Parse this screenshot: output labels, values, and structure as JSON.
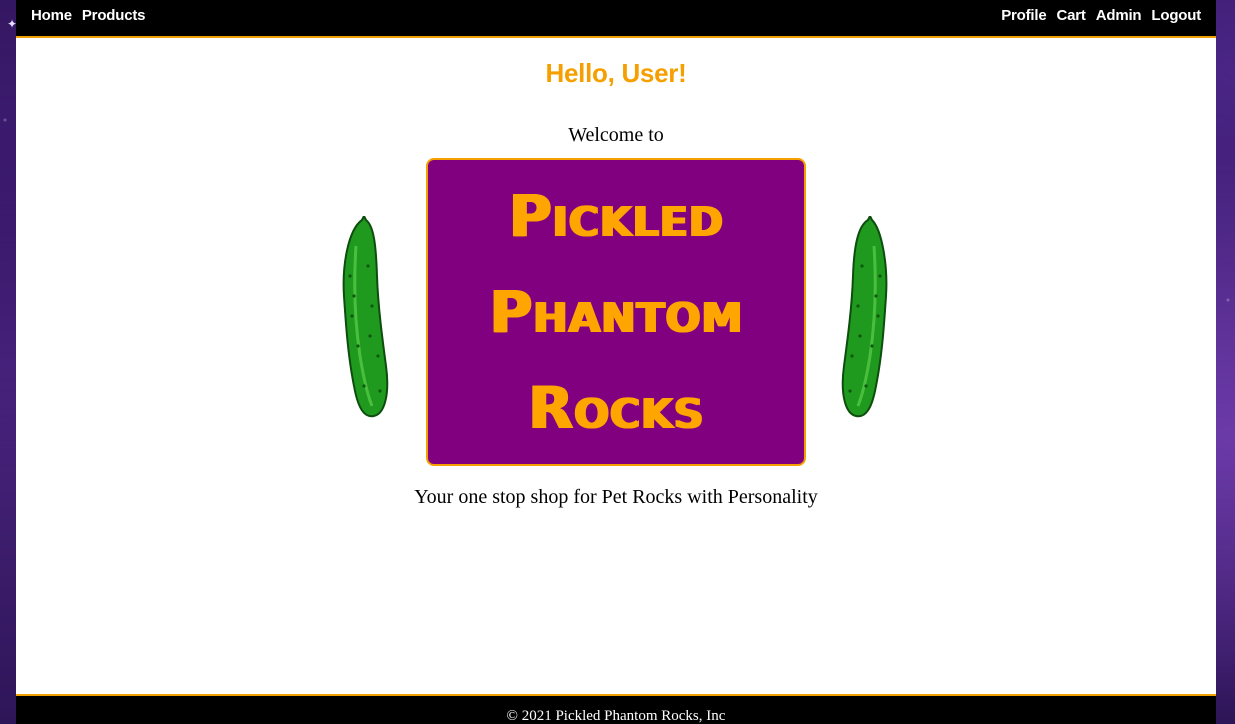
{
  "nav": {
    "left": [
      {
        "label": "Home"
      },
      {
        "label": "Products"
      }
    ],
    "right": [
      {
        "label": "Profile"
      },
      {
        "label": "Cart"
      },
      {
        "label": "Admin"
      },
      {
        "label": "Logout"
      }
    ]
  },
  "main": {
    "greeting": "Hello, User!",
    "welcome": "Welcome to",
    "logo": {
      "lines": [
        "Pickled",
        "Phantom",
        "Rocks"
      ]
    },
    "decorations": {
      "left_icon": "pickle-icon",
      "right_icon": "pickle-icon"
    },
    "tagline": "Your one stop shop for Pet Rocks with Personality"
  },
  "footer": {
    "copyright": "© 2021 Pickled Phantom Rocks, Inc"
  },
  "colors": {
    "accent": "#ffa500",
    "logo_background": "#800080",
    "nav_background": "#000000",
    "pickle_green": "#1a9a1a"
  }
}
